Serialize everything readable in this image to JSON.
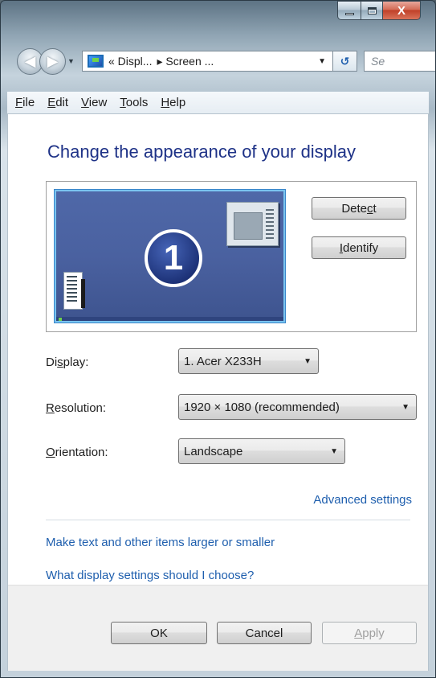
{
  "window": {
    "caption_buttons": {
      "close_label": "X"
    }
  },
  "navbar": {
    "address_parts": [
      "« Displ...",
      "▸ Screen ..."
    ],
    "search_placeholder": "Se"
  },
  "menu": [
    {
      "label": "File",
      "accel": "F",
      "rest": "ile"
    },
    {
      "label": "Edit",
      "accel": "E",
      "rest": "dit"
    },
    {
      "label": "View",
      "accel": "V",
      "rest": "iew"
    },
    {
      "label": "Tools",
      "accel": "T",
      "rest": "ools"
    },
    {
      "label": "Help",
      "accel": "H",
      "rest": "elp"
    }
  ],
  "main": {
    "title": "Change the appearance of your display",
    "monitor_number": "1",
    "detect_pre": "Dete",
    "detect_accel": "c",
    "detect_post": "t",
    "identify_accel": "I",
    "identify_post": "dentify"
  },
  "settings": {
    "display": {
      "pre": "Di",
      "accel": "s",
      "post": "play:",
      "value": "1. Acer X233H"
    },
    "resolution": {
      "accel": "R",
      "post": "esolution:",
      "value": "1920 × 1080 (recommended)"
    },
    "orientation": {
      "accel": "O",
      "post": "rientation:",
      "value": "Landscape"
    }
  },
  "links": {
    "advanced": "Advanced settings",
    "text_size": "Make text and other items larger or smaller",
    "which_settings": "What display settings should I choose?"
  },
  "footer": {
    "ok": "OK",
    "cancel": "Cancel",
    "apply_accel": "A",
    "apply_post": "pply"
  }
}
